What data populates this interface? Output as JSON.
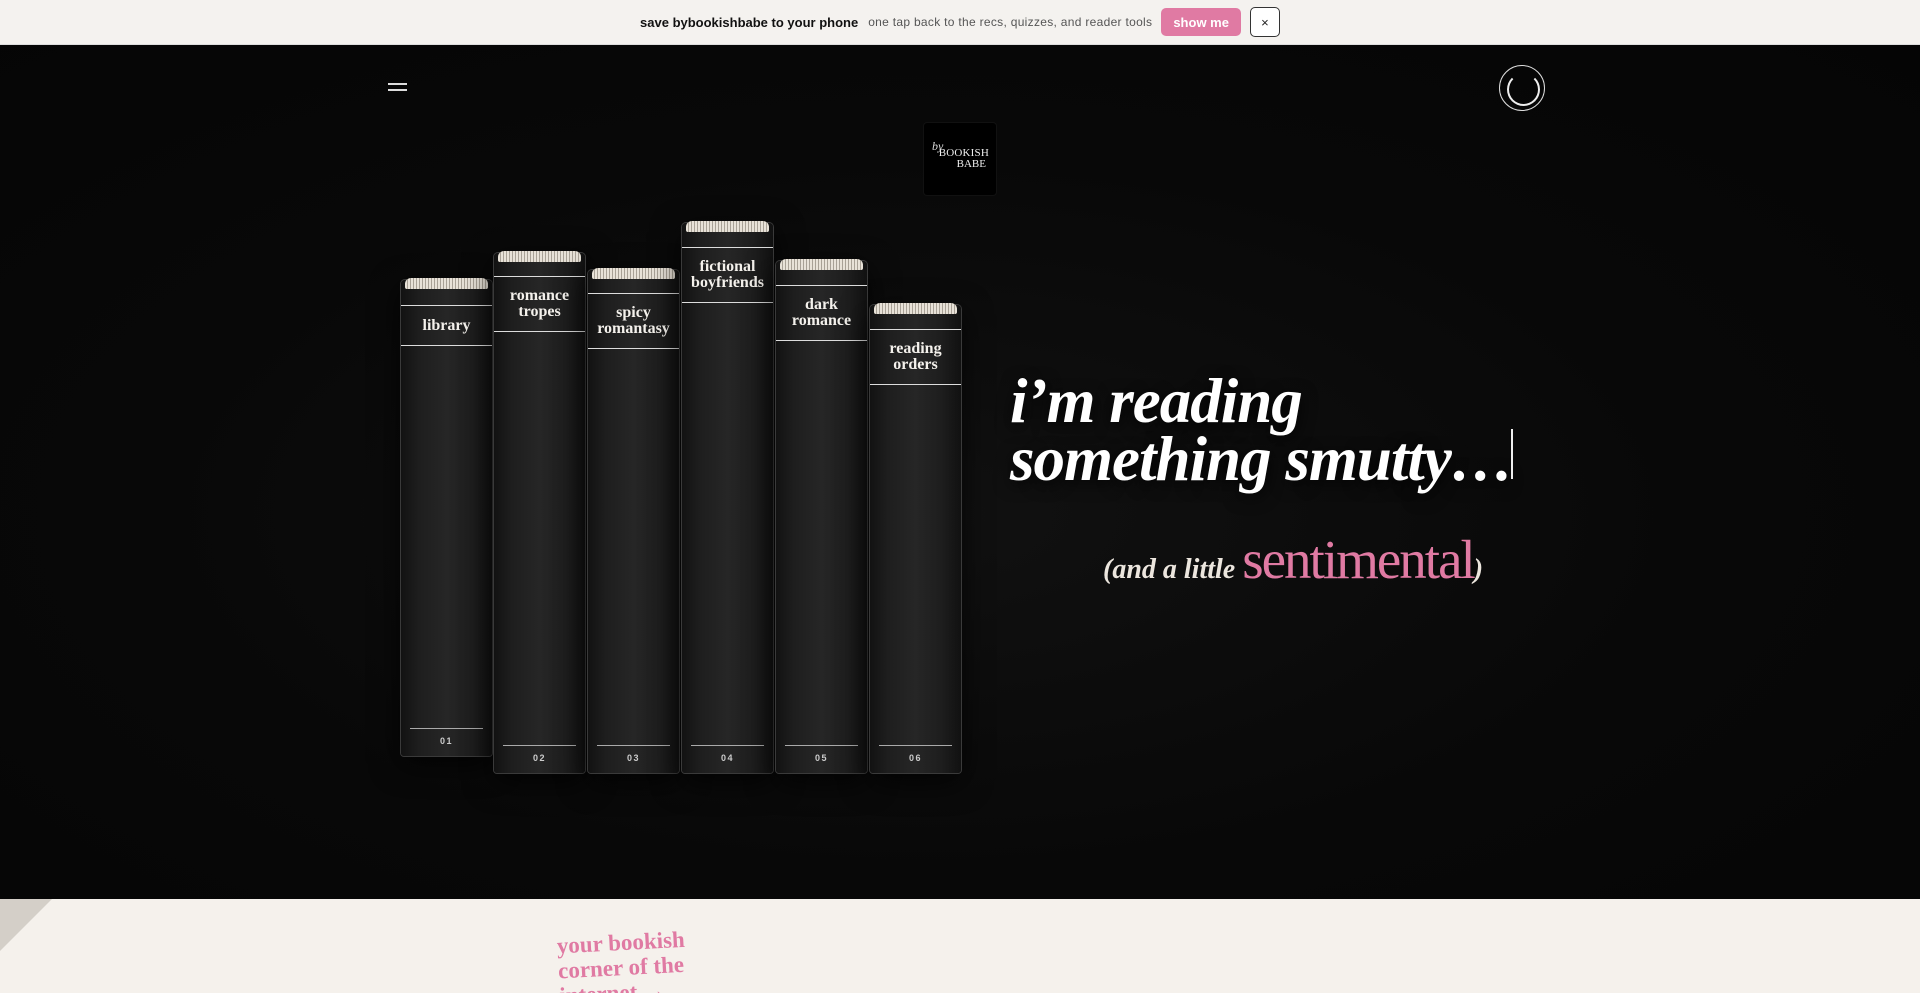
{
  "banner": {
    "title": "save bybookishbabe to your phone",
    "subtitle": "one tap back to the recs, quizzes, and reader tools",
    "cta_label": "show me",
    "close_label": "×"
  },
  "logo": {
    "by": "by",
    "line1": "BOOKISH",
    "line2": "BABE"
  },
  "books": [
    {
      "label": "library",
      "number": "01"
    },
    {
      "label": "romance tropes",
      "number": "02"
    },
    {
      "label": "spicy romantasy",
      "number": "03"
    },
    {
      "label": "fictional boyfriends",
      "number": "04"
    },
    {
      "label": "dark romance",
      "number": "05"
    },
    {
      "label": "reading orders",
      "number": "06"
    }
  ],
  "hero": {
    "line1": "i’m reading",
    "line2": "something smutty…",
    "sub_prefix": "(and a little ",
    "sub_accent": "sentimental",
    "sub_suffix": ")"
  },
  "lower": {
    "tagline": "your bookish corner of the internet →"
  }
}
